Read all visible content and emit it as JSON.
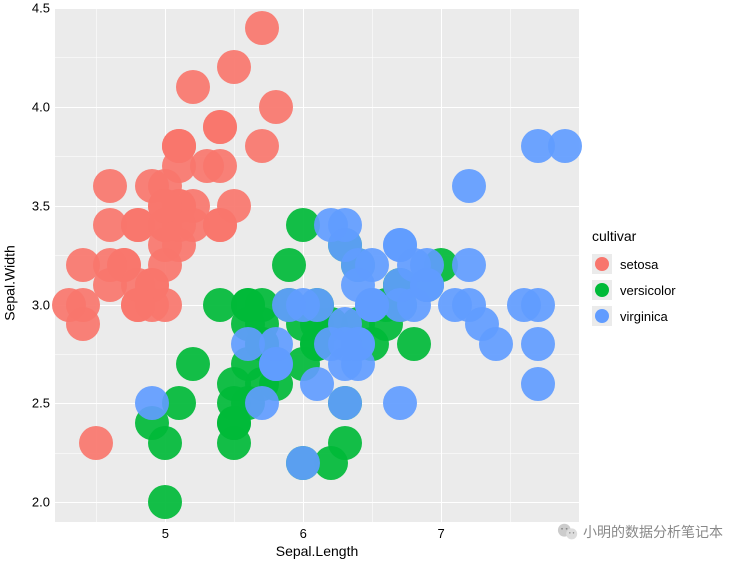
{
  "chart_data": {
    "type": "scatter",
    "title": "",
    "xlabel": "Sepal.Length",
    "ylabel": "Sepal.Width",
    "xlim": [
      4.2,
      8.0
    ],
    "ylim": [
      1.9,
      4.5
    ],
    "x_ticks": [
      5,
      6,
      7
    ],
    "y_ticks": [
      2.0,
      2.5,
      3.0,
      3.5,
      4.0,
      4.5
    ],
    "legend_title": "cultivar",
    "series": [
      {
        "name": "setosa",
        "color": "#F8766D",
        "points": [
          [
            5.1,
            3.5
          ],
          [
            4.9,
            3.0
          ],
          [
            4.7,
            3.2
          ],
          [
            4.6,
            3.1
          ],
          [
            5.0,
            3.6
          ],
          [
            5.4,
            3.9
          ],
          [
            4.6,
            3.4
          ],
          [
            5.0,
            3.4
          ],
          [
            4.4,
            2.9
          ],
          [
            4.9,
            3.1
          ],
          [
            5.4,
            3.7
          ],
          [
            4.8,
            3.4
          ],
          [
            4.8,
            3.0
          ],
          [
            4.3,
            3.0
          ],
          [
            5.8,
            4.0
          ],
          [
            5.7,
            4.4
          ],
          [
            5.4,
            3.9
          ],
          [
            5.1,
            3.5
          ],
          [
            5.7,
            3.8
          ],
          [
            5.1,
            3.8
          ],
          [
            5.4,
            3.4
          ],
          [
            5.1,
            3.7
          ],
          [
            4.6,
            3.6
          ],
          [
            5.1,
            3.3
          ],
          [
            4.8,
            3.4
          ],
          [
            5.0,
            3.0
          ],
          [
            5.0,
            3.4
          ],
          [
            5.2,
            3.5
          ],
          [
            5.2,
            3.4
          ],
          [
            4.7,
            3.2
          ],
          [
            4.8,
            3.1
          ],
          [
            5.4,
            3.4
          ],
          [
            5.2,
            4.1
          ],
          [
            5.5,
            4.2
          ],
          [
            4.9,
            3.1
          ],
          [
            5.0,
            3.2
          ],
          [
            5.5,
            3.5
          ],
          [
            4.9,
            3.6
          ],
          [
            4.4,
            3.0
          ],
          [
            5.1,
            3.4
          ],
          [
            5.0,
            3.5
          ],
          [
            4.5,
            2.3
          ],
          [
            4.4,
            3.2
          ],
          [
            5.0,
            3.5
          ],
          [
            5.1,
            3.8
          ],
          [
            4.8,
            3.0
          ],
          [
            5.1,
            3.8
          ],
          [
            4.6,
            3.2
          ],
          [
            5.3,
            3.7
          ],
          [
            5.0,
            3.3
          ]
        ]
      },
      {
        "name": "versicolor",
        "color": "#00BA38",
        "points": [
          [
            7.0,
            3.2
          ],
          [
            6.4,
            3.2
          ],
          [
            6.9,
            3.1
          ],
          [
            5.5,
            2.3
          ],
          [
            6.5,
            2.8
          ],
          [
            5.7,
            2.8
          ],
          [
            6.3,
            3.3
          ],
          [
            4.9,
            2.4
          ],
          [
            6.6,
            2.9
          ],
          [
            5.2,
            2.7
          ],
          [
            5.0,
            2.0
          ],
          [
            5.9,
            3.0
          ],
          [
            6.0,
            2.2
          ],
          [
            6.1,
            2.9
          ],
          [
            5.6,
            2.9
          ],
          [
            6.7,
            3.1
          ],
          [
            5.6,
            3.0
          ],
          [
            5.8,
            2.7
          ],
          [
            6.2,
            2.2
          ],
          [
            5.6,
            2.5
          ],
          [
            5.9,
            3.2
          ],
          [
            6.1,
            2.8
          ],
          [
            6.3,
            2.5
          ],
          [
            6.1,
            2.8
          ],
          [
            6.4,
            2.9
          ],
          [
            6.6,
            3.0
          ],
          [
            6.8,
            2.8
          ],
          [
            6.7,
            3.0
          ],
          [
            6.0,
            2.9
          ],
          [
            5.7,
            2.6
          ],
          [
            5.5,
            2.4
          ],
          [
            5.5,
            2.4
          ],
          [
            5.8,
            2.7
          ],
          [
            6.0,
            2.7
          ],
          [
            5.4,
            3.0
          ],
          [
            6.0,
            3.4
          ],
          [
            6.7,
            3.1
          ],
          [
            6.3,
            2.3
          ],
          [
            5.6,
            3.0
          ],
          [
            5.5,
            2.5
          ],
          [
            5.5,
            2.6
          ],
          [
            6.1,
            3.0
          ],
          [
            5.8,
            2.6
          ],
          [
            5.0,
            2.3
          ],
          [
            5.6,
            2.7
          ],
          [
            5.7,
            3.0
          ],
          [
            5.7,
            2.9
          ],
          [
            6.2,
            2.9
          ],
          [
            5.1,
            2.5
          ],
          [
            5.7,
            2.8
          ]
        ]
      },
      {
        "name": "virginica",
        "color": "#619CFF",
        "points": [
          [
            6.3,
            3.3
          ],
          [
            5.8,
            2.7
          ],
          [
            7.1,
            3.0
          ],
          [
            6.3,
            2.9
          ],
          [
            6.5,
            3.0
          ],
          [
            7.6,
            3.0
          ],
          [
            4.9,
            2.5
          ],
          [
            7.3,
            2.9
          ],
          [
            6.7,
            2.5
          ],
          [
            7.2,
            3.6
          ],
          [
            6.5,
            3.2
          ],
          [
            6.4,
            2.7
          ],
          [
            6.8,
            3.0
          ],
          [
            5.7,
            2.5
          ],
          [
            5.8,
            2.8
          ],
          [
            6.4,
            3.2
          ],
          [
            6.5,
            3.0
          ],
          [
            7.7,
            3.8
          ],
          [
            7.7,
            2.6
          ],
          [
            6.0,
            2.2
          ],
          [
            6.9,
            3.2
          ],
          [
            5.6,
            2.8
          ],
          [
            7.7,
            2.8
          ],
          [
            6.3,
            2.7
          ],
          [
            6.7,
            3.3
          ],
          [
            7.2,
            3.2
          ],
          [
            6.2,
            2.8
          ],
          [
            6.1,
            3.0
          ],
          [
            6.4,
            2.8
          ],
          [
            7.2,
            3.0
          ],
          [
            7.4,
            2.8
          ],
          [
            7.9,
            3.8
          ],
          [
            6.4,
            2.8
          ],
          [
            6.3,
            2.8
          ],
          [
            6.1,
            2.6
          ],
          [
            7.7,
            3.0
          ],
          [
            6.3,
            3.4
          ],
          [
            6.4,
            3.1
          ],
          [
            6.0,
            3.0
          ],
          [
            6.9,
            3.1
          ],
          [
            6.7,
            3.1
          ],
          [
            6.9,
            3.1
          ],
          [
            5.8,
            2.7
          ],
          [
            6.8,
            3.2
          ],
          [
            6.7,
            3.3
          ],
          [
            6.7,
            3.0
          ],
          [
            6.3,
            2.5
          ],
          [
            6.5,
            3.0
          ],
          [
            6.2,
            3.4
          ],
          [
            5.9,
            3.0
          ]
        ]
      }
    ]
  },
  "watermark": {
    "text": "小明的数据分析笔记本",
    "icon": "wechat"
  }
}
